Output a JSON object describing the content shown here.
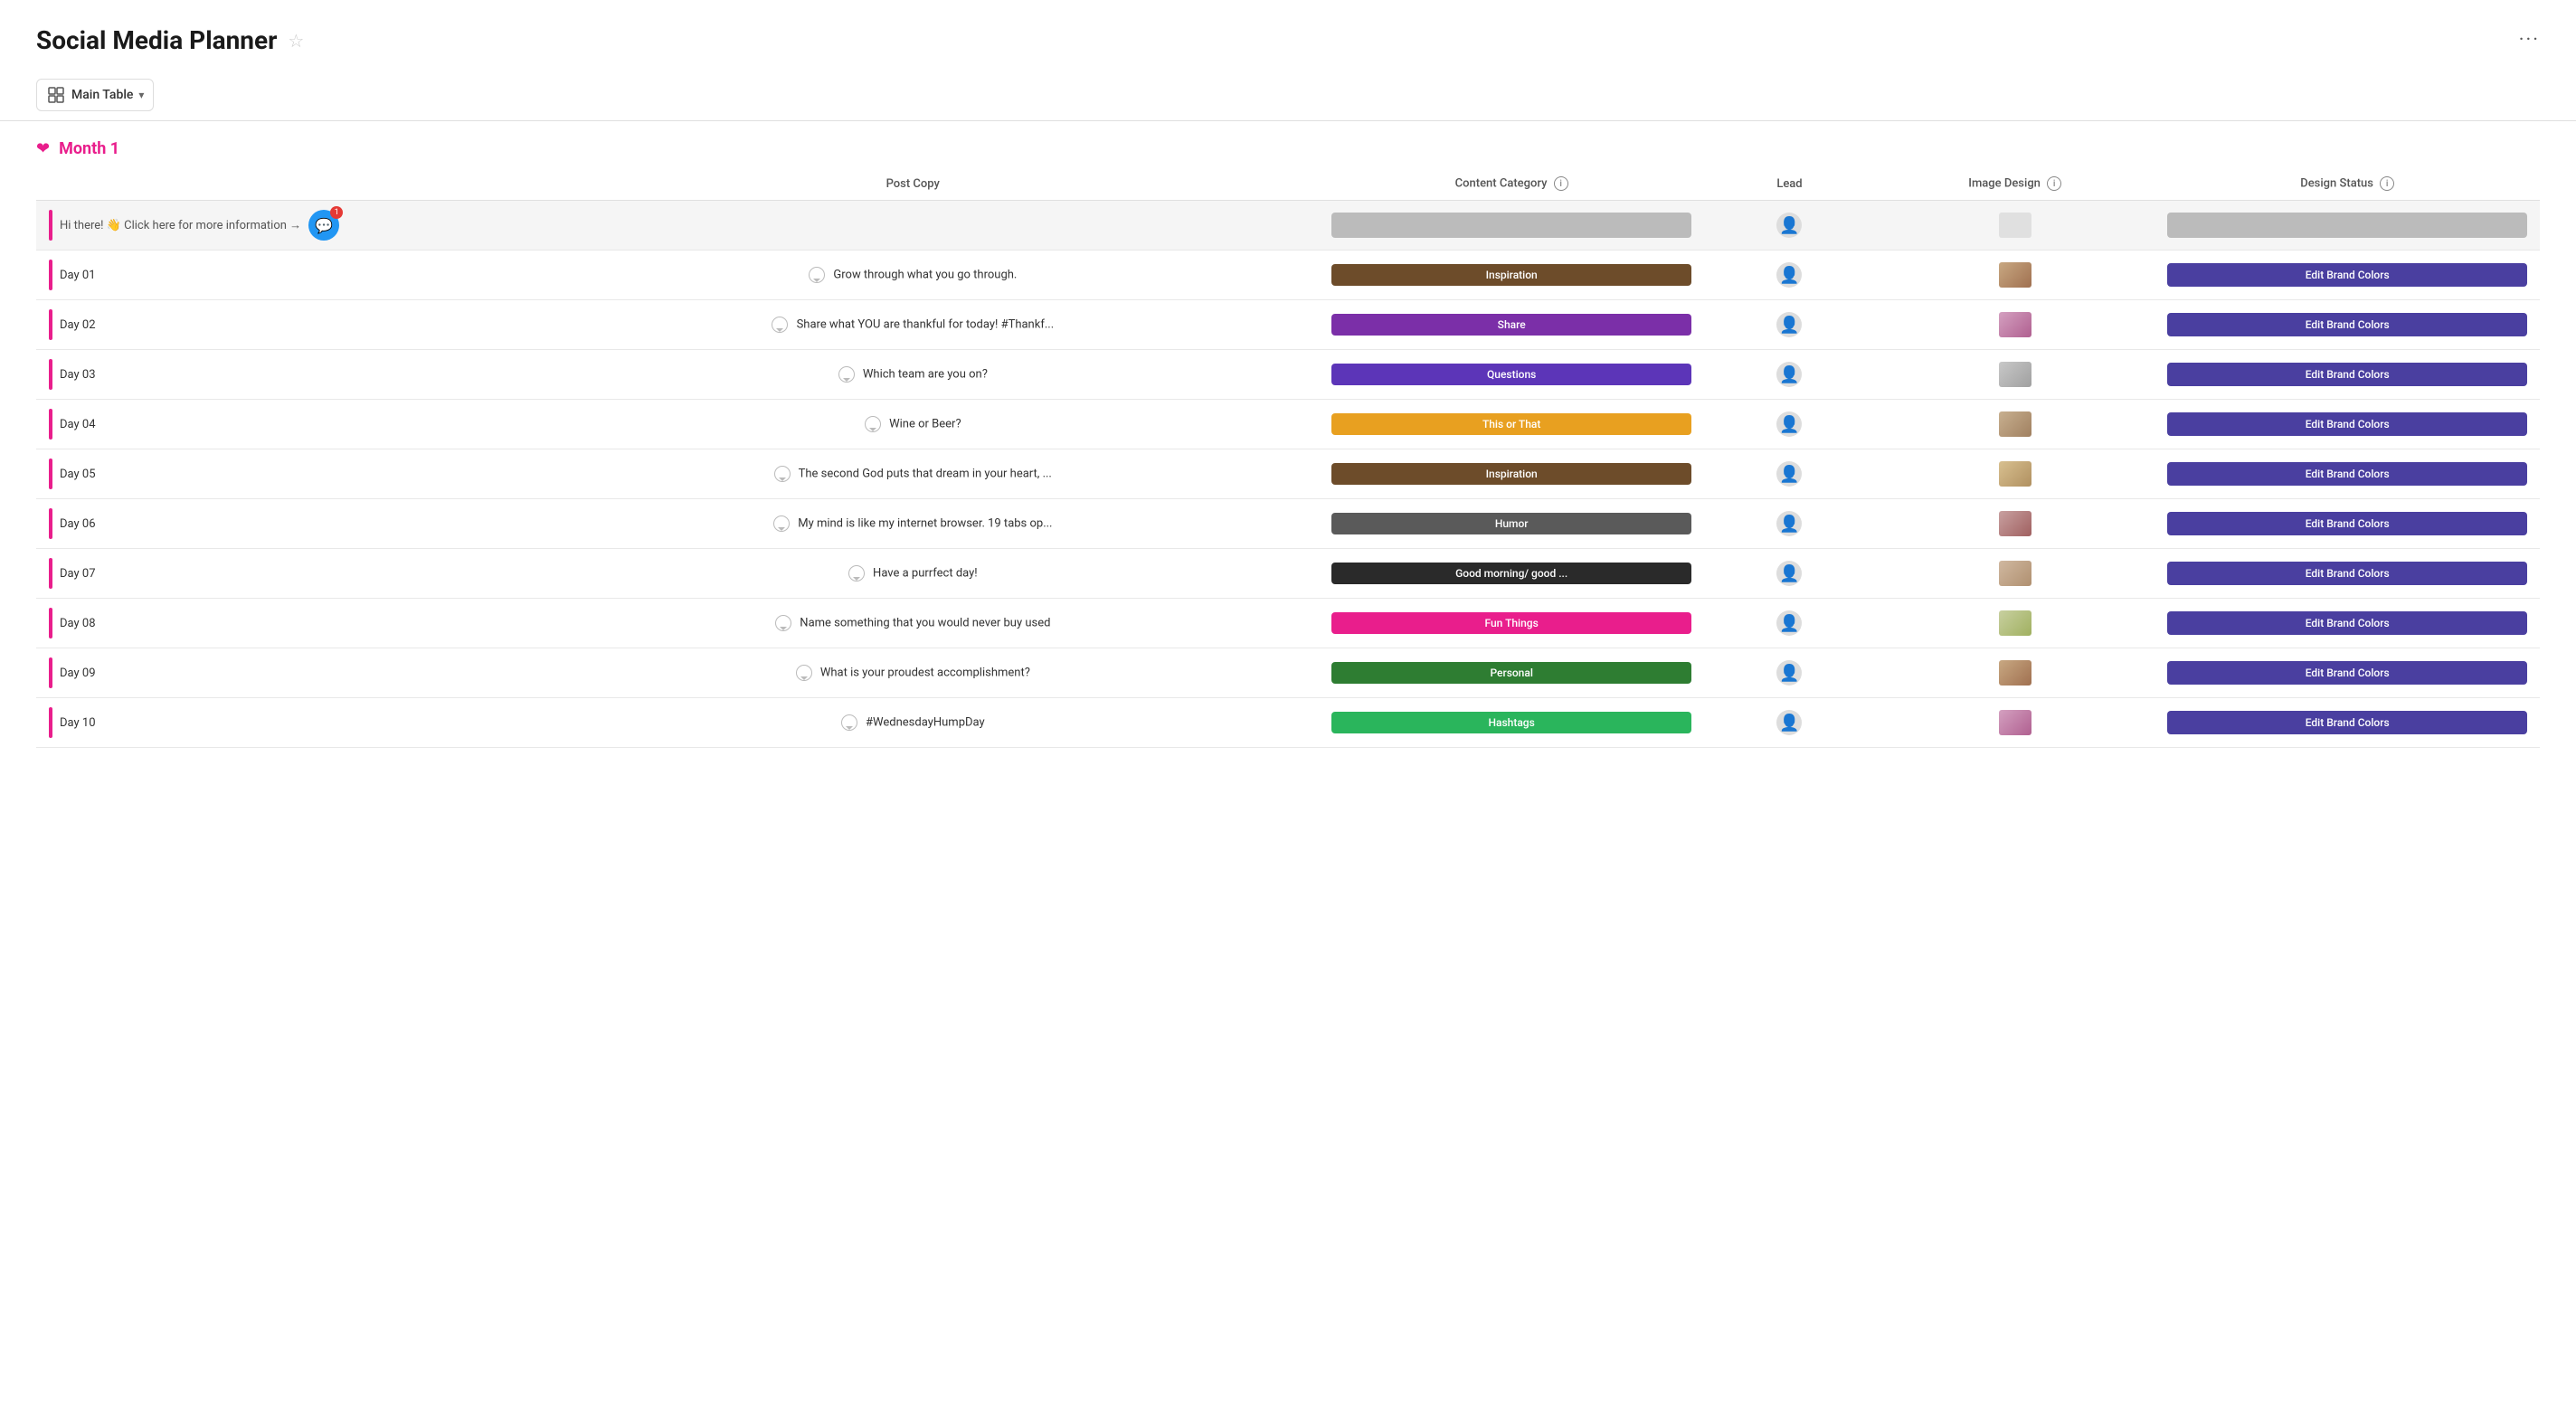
{
  "header": {
    "title": "Social Media Planner",
    "more_label": "···"
  },
  "toolbar": {
    "table_name": "Main Table",
    "table_icon": "⊞"
  },
  "group": {
    "title": "Month 1"
  },
  "table": {
    "columns": [
      {
        "key": "name",
        "label": ""
      },
      {
        "key": "post_copy",
        "label": "Post Copy"
      },
      {
        "key": "content_category",
        "label": "Content Category",
        "has_info": true
      },
      {
        "key": "lead",
        "label": "Lead"
      },
      {
        "key": "image_design",
        "label": "Image Design",
        "has_info": true
      },
      {
        "key": "design_status",
        "label": "Design Status",
        "has_info": true
      }
    ],
    "info_row": {
      "text": "Hi there! 👋 Click here for more information →",
      "has_chat": true,
      "chat_badge": "1"
    },
    "rows": [
      {
        "name": "Day 01",
        "post_copy": "Grow through what you go through.",
        "category": "Inspiration",
        "category_class": "cat-inspiration",
        "img_class": "img-th-1",
        "status": "Edit Brand Colors"
      },
      {
        "name": "Day 02",
        "post_copy": "Share what YOU are thankful for today! #Thankf...",
        "category": "Share",
        "category_class": "cat-share",
        "img_class": "img-th-2",
        "status": "Edit Brand Colors"
      },
      {
        "name": "Day 03",
        "post_copy": "Which team are you on?",
        "category": "Questions",
        "category_class": "cat-questions",
        "img_class": "img-th-3",
        "status": "Edit Brand Colors"
      },
      {
        "name": "Day 04",
        "post_copy": "Wine or Beer?",
        "category": "This or That",
        "category_class": "cat-thisorthat",
        "img_class": "img-th-4",
        "status": "Edit Brand Colors"
      },
      {
        "name": "Day 05",
        "post_copy": "The second God puts that dream in your heart, ...",
        "category": "Inspiration",
        "category_class": "cat-inspiration",
        "img_class": "img-th-5",
        "status": "Edit Brand Colors"
      },
      {
        "name": "Day 06",
        "post_copy": "My mind is like my internet browser. 19 tabs op...",
        "category": "Humor",
        "category_class": "cat-humor",
        "img_class": "img-th-6",
        "status": "Edit Brand Colors"
      },
      {
        "name": "Day 07",
        "post_copy": "Have a purrfect day!",
        "category": "Good morning/ good ...",
        "category_class": "cat-goodmorning",
        "img_class": "img-th-7",
        "status": "Edit Brand Colors"
      },
      {
        "name": "Day 08",
        "post_copy": "Name something that you would never buy used",
        "category": "Fun Things",
        "category_class": "cat-funthings",
        "img_class": "img-th-8",
        "status": "Edit Brand Colors"
      },
      {
        "name": "Day 09",
        "post_copy": "What is your proudest accomplishment?",
        "category": "Personal",
        "category_class": "cat-personal",
        "img_class": "img-th-1",
        "status": "Edit Brand Colors"
      },
      {
        "name": "Day 10",
        "post_copy": "#WednesdayHumpDay",
        "category": "Hashtags",
        "category_class": "cat-hashtags",
        "img_class": "img-th-2",
        "status": "Edit Brand Colors"
      }
    ]
  }
}
